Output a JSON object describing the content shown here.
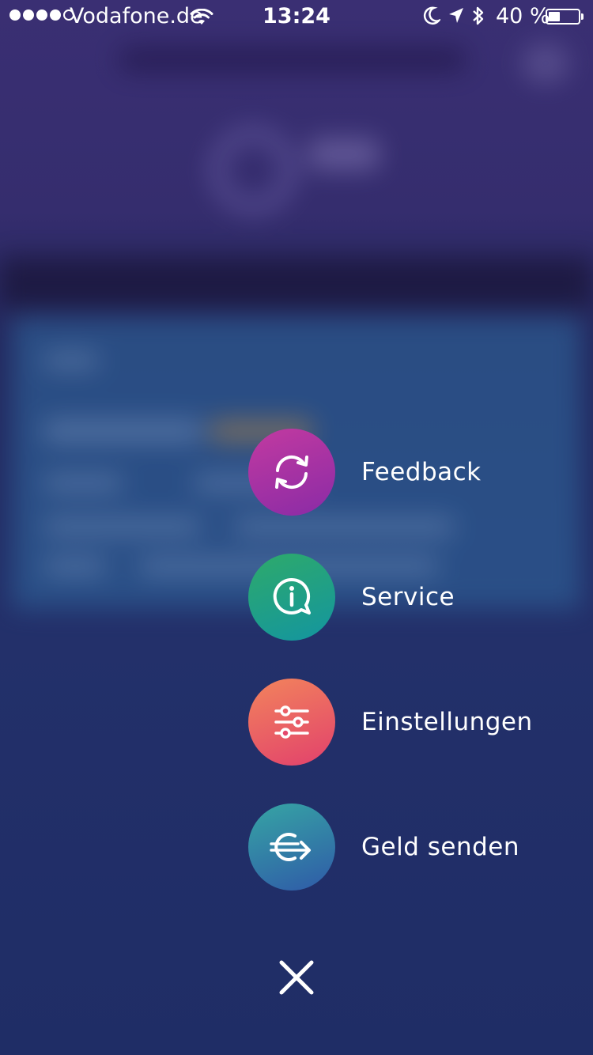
{
  "status_bar": {
    "carrier": "Vodafone.de",
    "time": "13:24",
    "battery_percent": "40 %",
    "battery_level": 0.4,
    "signal_bars_filled": 4,
    "signal_bars_total": 5,
    "icons": [
      "wifi-icon",
      "moon-icon",
      "location-arrow-icon",
      "bluetooth-icon",
      "battery-icon"
    ]
  },
  "menu": {
    "items": [
      {
        "label": "Feedback",
        "icon": "refresh-arrows-icon",
        "color_from": "#c23aa0",
        "color_to": "#8a2ba6"
      },
      {
        "label": "Service",
        "icon": "info-speech-bubble-icon",
        "color_from": "#2eaa6a",
        "color_to": "#1395a0"
      },
      {
        "label": "Einstellungen",
        "icon": "sliders-icon",
        "color_from": "#f2845c",
        "color_to": "#e2416c"
      },
      {
        "label": "Geld senden",
        "icon": "currency-arrow-icon",
        "color_from": "#36a5a4",
        "color_to": "#2f5aa8"
      }
    ],
    "close_icon": "close-icon"
  }
}
